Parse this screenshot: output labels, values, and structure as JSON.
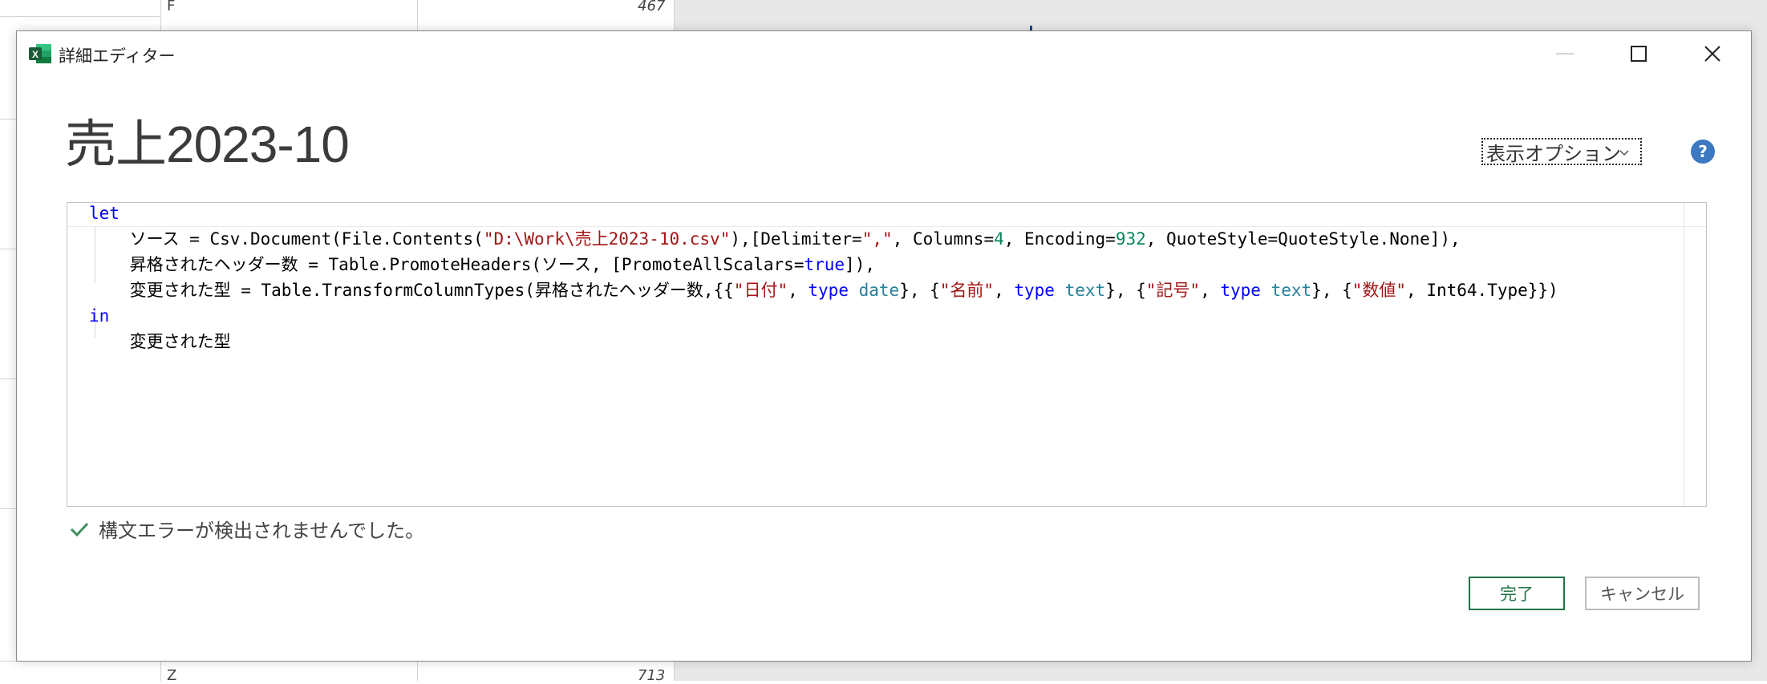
{
  "background": {
    "cell_top_left": "F",
    "cell_top_right": "467",
    "cell_bottom_left": "Z",
    "cell_bottom_right": "713"
  },
  "dialog": {
    "title": "詳細エディター",
    "query_name": "売上2023-10",
    "display_options_label": "表示オプション",
    "help_label": "?",
    "code_lines": [
      [
        {
          "t": "let",
          "c": "kw"
        }
      ],
      [
        {
          "t": "    ソース = Csv.Document(File.Contents(",
          "c": ""
        },
        {
          "t": "\"D:\\Work\\売上2023-10.csv\"",
          "c": "str"
        },
        {
          "t": "),[Delimiter=",
          "c": ""
        },
        {
          "t": "\",\"",
          "c": "str"
        },
        {
          "t": ", Columns=",
          "c": ""
        },
        {
          "t": "4",
          "c": "num"
        },
        {
          "t": ", Encoding=",
          "c": ""
        },
        {
          "t": "932",
          "c": "num"
        },
        {
          "t": ", QuoteStyle=QuoteStyle.None]),",
          "c": ""
        }
      ],
      [
        {
          "t": "    昇格されたヘッダー数 = Table.PromoteHeaders(ソース, [PromoteAllScalars=",
          "c": ""
        },
        {
          "t": "true",
          "c": "kw"
        },
        {
          "t": "]),",
          "c": ""
        }
      ],
      [
        {
          "t": "    変更された型 = Table.TransformColumnTypes(昇格されたヘッダー数,{{",
          "c": ""
        },
        {
          "t": "\"日付\"",
          "c": "str"
        },
        {
          "t": ", ",
          "c": ""
        },
        {
          "t": "type",
          "c": "kw"
        },
        {
          "t": " ",
          "c": ""
        },
        {
          "t": "date",
          "c": "typ"
        },
        {
          "t": "}, {",
          "c": ""
        },
        {
          "t": "\"名前\"",
          "c": "str"
        },
        {
          "t": ", ",
          "c": ""
        },
        {
          "t": "type",
          "c": "kw"
        },
        {
          "t": " ",
          "c": ""
        },
        {
          "t": "text",
          "c": "typ"
        },
        {
          "t": "}, {",
          "c": ""
        },
        {
          "t": "\"記号\"",
          "c": "str"
        },
        {
          "t": ", ",
          "c": ""
        },
        {
          "t": "type",
          "c": "kw"
        },
        {
          "t": " ",
          "c": ""
        },
        {
          "t": "text",
          "c": "typ"
        },
        {
          "t": "}, {",
          "c": ""
        },
        {
          "t": "\"数値\"",
          "c": "str"
        },
        {
          "t": ", Int64.Type}})",
          "c": ""
        }
      ],
      [
        {
          "t": "in",
          "c": "kw"
        }
      ],
      [
        {
          "t": "    変更された型",
          "c": ""
        }
      ]
    ],
    "status_text": "構文エラーが検出されませんでした。",
    "done_label": "完了",
    "cancel_label": "キャンセル"
  },
  "colors": {
    "keyword": "#0000ff",
    "string": "#a31515",
    "number": "#098658",
    "type": "#267f99",
    "excel_green": "#217346",
    "help_blue": "#3d79c2",
    "status_check": "#3c8d5f"
  },
  "icons": [
    "excel-icon",
    "minimize-icon",
    "maximize-icon",
    "close-icon",
    "chevron-down-icon",
    "help-icon",
    "checkmark-icon"
  ]
}
